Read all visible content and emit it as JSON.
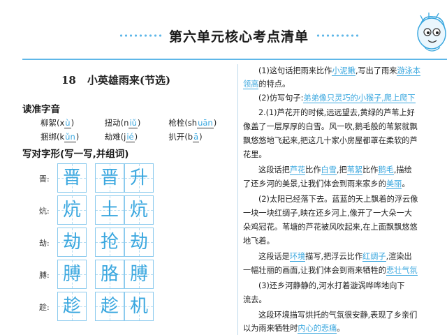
{
  "header": {
    "title": "第六单元核心考点清单"
  },
  "lesson": {
    "number": "18",
    "title": "小英雄雨来(节选)"
  },
  "read_section": {
    "heading": "读准字音",
    "rows": [
      [
        {
          "word": "柳絮",
          "pre": "(x",
          "ans": "ù",
          "post": ")"
        },
        {
          "word": "扭动",
          "pre": "(n",
          "ans": "iǔ",
          "post": ")"
        },
        {
          "word": "枪栓",
          "pre": "(sh",
          "ans": "uān",
          "post": ")"
        }
      ],
      [
        {
          "word": "捆绑",
          "pre": "(k",
          "ans": "ǔn",
          "post": ")"
        },
        {
          "word": "劫难",
          "pre": "(j",
          "ans": "ié",
          "post": ")"
        },
        {
          "word": "扒开",
          "pre": "(b",
          "ans": "ā",
          "post": ")"
        }
      ]
    ]
  },
  "write_section": {
    "heading": "写对字形(写一写,并组词)",
    "rows": [
      {
        "label": "晋:",
        "chars": [
          "晋",
          "晋",
          "升"
        ]
      },
      {
        "label": "炕:",
        "chars": [
          "炕",
          "土",
          "炕"
        ]
      },
      {
        "label": "劫:",
        "chars": [
          "劫",
          "抢",
          "劫"
        ]
      },
      {
        "label": "膊:",
        "chars": [
          "膊",
          "胳",
          "膊"
        ]
      },
      {
        "label": "趁:",
        "chars": [
          "趁",
          "趁",
          "机"
        ]
      }
    ]
  },
  "right_text": {
    "p1_a": "(1)这句话把雨来比作",
    "p1_hl1": "小泥鳅",
    "p1_b": ",写出了雨来",
    "p1_hl2": "游泳本",
    "p1_hl3": "领高",
    "p1_c": "的特点。",
    "p2_a": "(2)仿写句子:",
    "p2_hl": "弟弟像只灵巧的小猴子,爬上爬下",
    "p3": "2.(1)芦花开的时候,远远望去,黄绿的芦苇上好",
    "p4": "像盖了一层厚厚的白雪。风一吹,鹅毛般的苇絮就飘",
    "p5": "飘悠悠地飞起来,把这几十家小房屋都罩在柔软的芦",
    "p6": "花里。",
    "p7_a": "这段话把",
    "p7_hl1": "芦花",
    "p7_b": "比作",
    "p7_hl2": "白雪",
    "p7_c": ",把",
    "p7_hl3": "苇絮",
    "p7_d": "比作",
    "p7_hl4": "鹅毛",
    "p7_e": ",描绘",
    "p8_a": "了还乡河的美景,让我们体会到雨来家乡的",
    "p8_hl": "美丽",
    "p8_b": "。",
    "p9": "(2)太阳已经落下去。蓝蓝的天上飘着的浮云像",
    "p10": "一块一块红绸子,映在还乡河上,像开了一大朵一大",
    "p11": "朵鸡冠花。苇塘的芦花被风吹起来,在上面飘飘悠悠",
    "p12": "地飞着。",
    "p13_a": "这段话是",
    "p13_hl1": "环境",
    "p13_b": "描写,把浮云比作",
    "p13_hl2": "红绸子",
    "p13_c": ",渲染出",
    "p14_a": "一幅壮丽的画面,让我们体会到雨来牺牲的",
    "p14_hl": "悲壮气氛",
    "p15": "(3)还乡河静静的,河水打着漩涡哗哗地向下",
    "p16": "流去。",
    "p17": "这段环境描写烘托的气氛很安静,表现了乡亲们",
    "p18_a": "以为雨来牺牲时",
    "p18_hl": "内心的悲痛",
    "p18_b": "。"
  },
  "colors": {
    "accent": "#3aa7df",
    "rule": "#5fb7e8",
    "grid": "#8ccbee"
  }
}
